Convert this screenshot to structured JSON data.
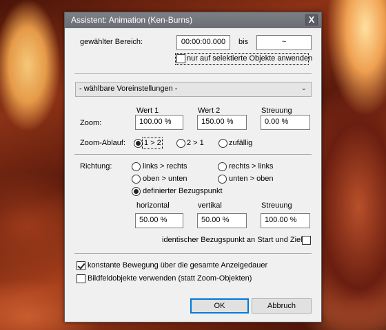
{
  "dialog": {
    "title": "Assistent: Animation (Ken-Burns)",
    "close_glyph": "X"
  },
  "range": {
    "label": "gewählter Bereich:",
    "start_value": "00:00:00.000",
    "to_label": "bis",
    "end_value": "~"
  },
  "selected_only": {
    "label": "nur auf selektierte Objekte anwenden",
    "checked": false
  },
  "presets": {
    "selected": "- wählbare Voreinstellungen -"
  },
  "zoom": {
    "label": "Zoom:",
    "col_value1": "Wert 1",
    "col_value2": "Wert 2",
    "col_spread": "Streuung",
    "value1": "100.00 %",
    "value2": "150.00 %",
    "spread": "0.00 %"
  },
  "zoom_sequence": {
    "label": "Zoom-Ablauf:",
    "options": [
      "1 > 2",
      "2 > 1",
      "zufällig"
    ],
    "selected": "1 > 2"
  },
  "direction": {
    "label": "Richtung:",
    "options": [
      "links > rechts",
      "rechts > links",
      "oben > unten",
      "unten > oben",
      "definierter Bezugspunkt"
    ],
    "selected": "definierter Bezugspunkt",
    "col_horizontal": "horizontal",
    "col_vertical": "vertikal",
    "col_spread": "Streuung",
    "horizontal": "50.00 %",
    "vertical": "50.00 %",
    "spread": "100.00 %",
    "identical_label": "identischer Bezugspunkt an Start und Ziel",
    "identical_checked": false
  },
  "options": {
    "constant_motion_label": "konstante Bewegung über die gesamte Anzeigedauer",
    "constant_motion_checked": true,
    "frame_objects_label": "Bildfeldobjekte verwenden (statt Zoom-Objekten)",
    "frame_objects_checked": false
  },
  "buttons": {
    "ok": "OK",
    "cancel": "Abbruch"
  }
}
